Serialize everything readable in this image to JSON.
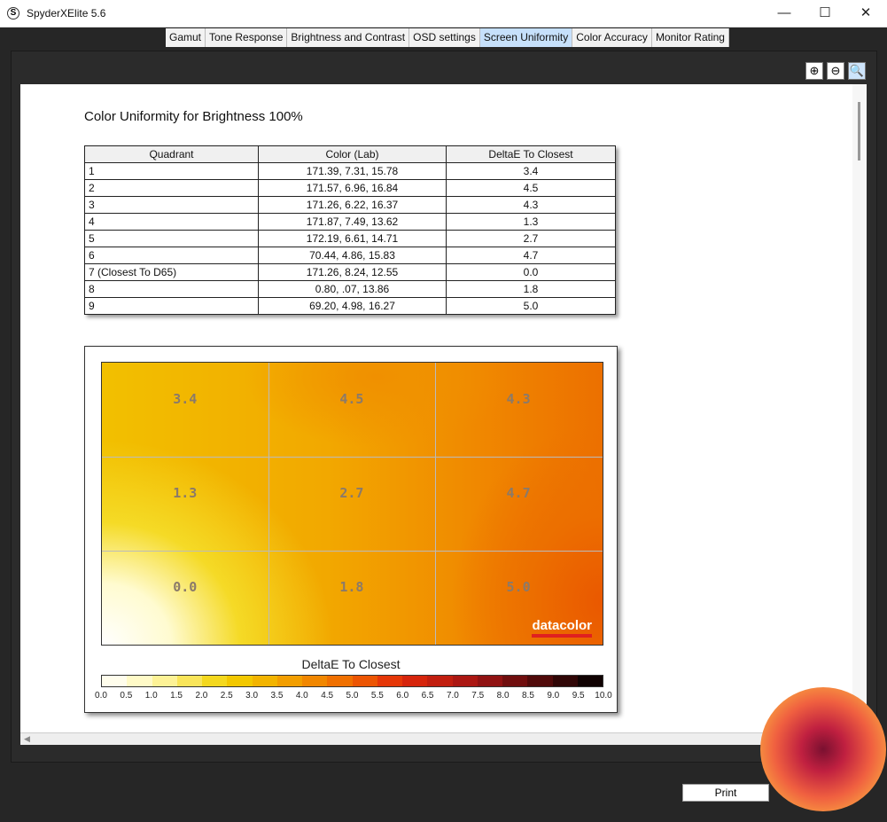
{
  "window": {
    "title": "SpyderXElite 5.6",
    "app_icon": "S",
    "minimize": "—",
    "maximize": "☐",
    "close": "✕"
  },
  "tabs": [
    {
      "label": "Gamut"
    },
    {
      "label": "Tone Response"
    },
    {
      "label": "Brightness and Contrast"
    },
    {
      "label": "OSD settings"
    },
    {
      "label": "Screen Uniformity",
      "active": true
    },
    {
      "label": "Color Accuracy"
    },
    {
      "label": "Monitor Rating"
    }
  ],
  "zoom": {
    "in": "⊕",
    "out": "⊖",
    "fit": "🔍"
  },
  "report": {
    "heading": "Color Uniformity for Brightness 100%",
    "table": {
      "headers": [
        "Quadrant",
        "Color (Lab)",
        "DeltaE To Closest"
      ],
      "rows": [
        [
          "1",
          "171.39,  7.31,  15.78",
          "3.4"
        ],
        [
          "2",
          "171.57,  6.96,  16.84",
          "4.5"
        ],
        [
          "3",
          "171.26,  6.22,  16.37",
          "4.3"
        ],
        [
          "4",
          "171.87,  7.49,  13.62",
          "1.3"
        ],
        [
          "5",
          "172.19,  6.61,  14.71",
          "2.7"
        ],
        [
          "6",
          "70.44,  4.86,  15.83",
          "4.7"
        ],
        [
          "7 (Closest To D65)",
          "171.26,  8.24,  12.55",
          "0.0"
        ],
        [
          "8",
          "0.80,    .07,  13.86",
          "1.8"
        ],
        [
          "9",
          "69.20,  4.98,  16.27",
          "5.0"
        ]
      ]
    }
  },
  "chart_data": {
    "type": "heatmap",
    "title": "DeltaE To Closest",
    "grid": [
      [
        "3.4",
        "4.5",
        "4.3"
      ],
      [
        "1.3",
        "2.7",
        "4.7"
      ],
      [
        "0.0",
        "1.8",
        "5.0"
      ]
    ],
    "colorbar_ticks": [
      "0.0",
      "0.5",
      "1.0",
      "1.5",
      "2.0",
      "2.5",
      "3.0",
      "3.5",
      "4.0",
      "4.5",
      "5.0",
      "5.5",
      "6.0",
      "6.5",
      "7.0",
      "7.5",
      "8.0",
      "8.5",
      "9.0",
      "9.5",
      "10.0"
    ],
    "range": [
      0,
      10
    ],
    "brand": "datacolor"
  },
  "footer": {
    "print": "Print"
  }
}
